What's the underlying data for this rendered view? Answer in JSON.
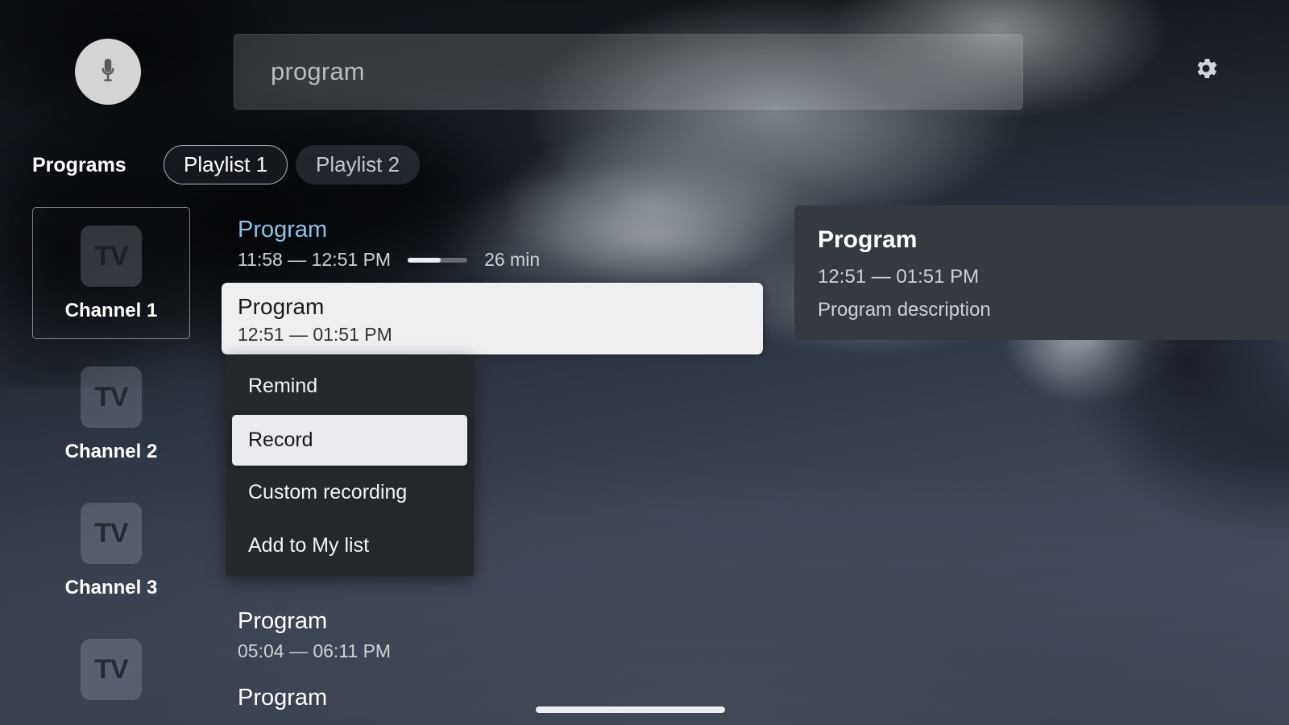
{
  "app": {
    "background_tone": "#3c4454"
  },
  "topbar": {
    "mic_icon": "microphone-icon",
    "settings_icon": "gear-icon",
    "search": {
      "value": "",
      "placeholder": "program"
    }
  },
  "playlists": {
    "section_label": "Programs",
    "tabs": [
      {
        "label": "Playlist 1",
        "selected": true
      },
      {
        "label": "Playlist 2",
        "selected": false
      }
    ]
  },
  "channels": {
    "tile_text": "TV",
    "items": [
      {
        "name": "Channel 1",
        "focused": true
      },
      {
        "name": "Channel 2",
        "focused": false
      },
      {
        "name": "Channel 3",
        "focused": false
      },
      {
        "name": "",
        "focused": false
      }
    ]
  },
  "programs": {
    "now": {
      "title": "Program",
      "time": "11:58 — 12:51 PM",
      "remaining": "26 min",
      "progress_percent": 55
    },
    "selected": {
      "title": "Program",
      "time": "12:51 — 01:51 PM"
    },
    "later": {
      "title": "Program",
      "time": "05:04 — 06:11 PM"
    },
    "clipped": {
      "title": "Program"
    }
  },
  "context_menu": {
    "items": [
      {
        "label": "Remind",
        "highlighted": false
      },
      {
        "label": "Record",
        "highlighted": true
      },
      {
        "label": "Custom recording",
        "highlighted": false
      },
      {
        "label": "Add to My list",
        "highlighted": false
      }
    ]
  },
  "detail": {
    "title": "Program",
    "time": "12:51 — 01:51 PM",
    "description": "Program description"
  },
  "colors": {
    "accent_program": "#8fc2e8",
    "menu_bg": "#24282d",
    "highlight_bg": "#e9ebee",
    "panel_bg": "#343a40",
    "card_bg": "#edeff1"
  }
}
